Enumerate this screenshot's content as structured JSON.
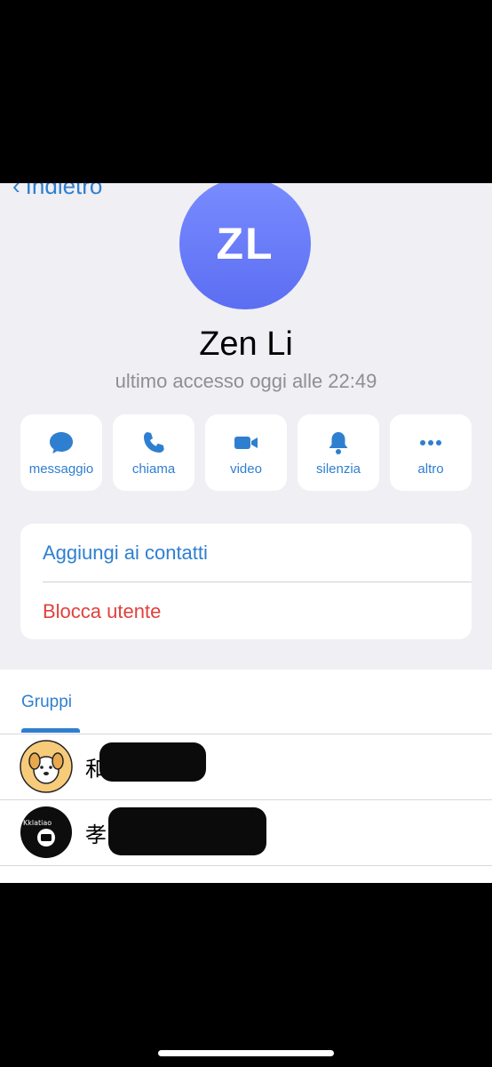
{
  "nav": {
    "back_label": "Indietro"
  },
  "profile": {
    "initials": "ZL",
    "name": "Zen Li",
    "status": "ultimo accesso oggi alle 22:49",
    "avatar_colors": [
      "#7a8cff",
      "#5b6ef2"
    ]
  },
  "actions": [
    {
      "icon": "message-bubble-icon",
      "label": "messaggio"
    },
    {
      "icon": "phone-icon",
      "label": "chiama"
    },
    {
      "icon": "video-camera-icon",
      "label": "video"
    },
    {
      "icon": "bell-icon",
      "label": "silenzia"
    },
    {
      "icon": "more-dots-icon",
      "label": "altro"
    }
  ],
  "options": {
    "add_contact": "Aggiungi ai contatti",
    "block_user": "Blocca utente"
  },
  "groups": {
    "tab_label": "Gruppi",
    "items": [
      {
        "name_visible": "和",
        "avatar_icon": "dog-avatar-icon"
      },
      {
        "name_visible": "孝",
        "avatar_icon": "tv-logo-avatar-icon",
        "avatar_text": "Kklatiao"
      }
    ]
  },
  "colors": {
    "accent": "#2f7fd0",
    "danger": "#e0413c",
    "background": "#efeff4"
  }
}
